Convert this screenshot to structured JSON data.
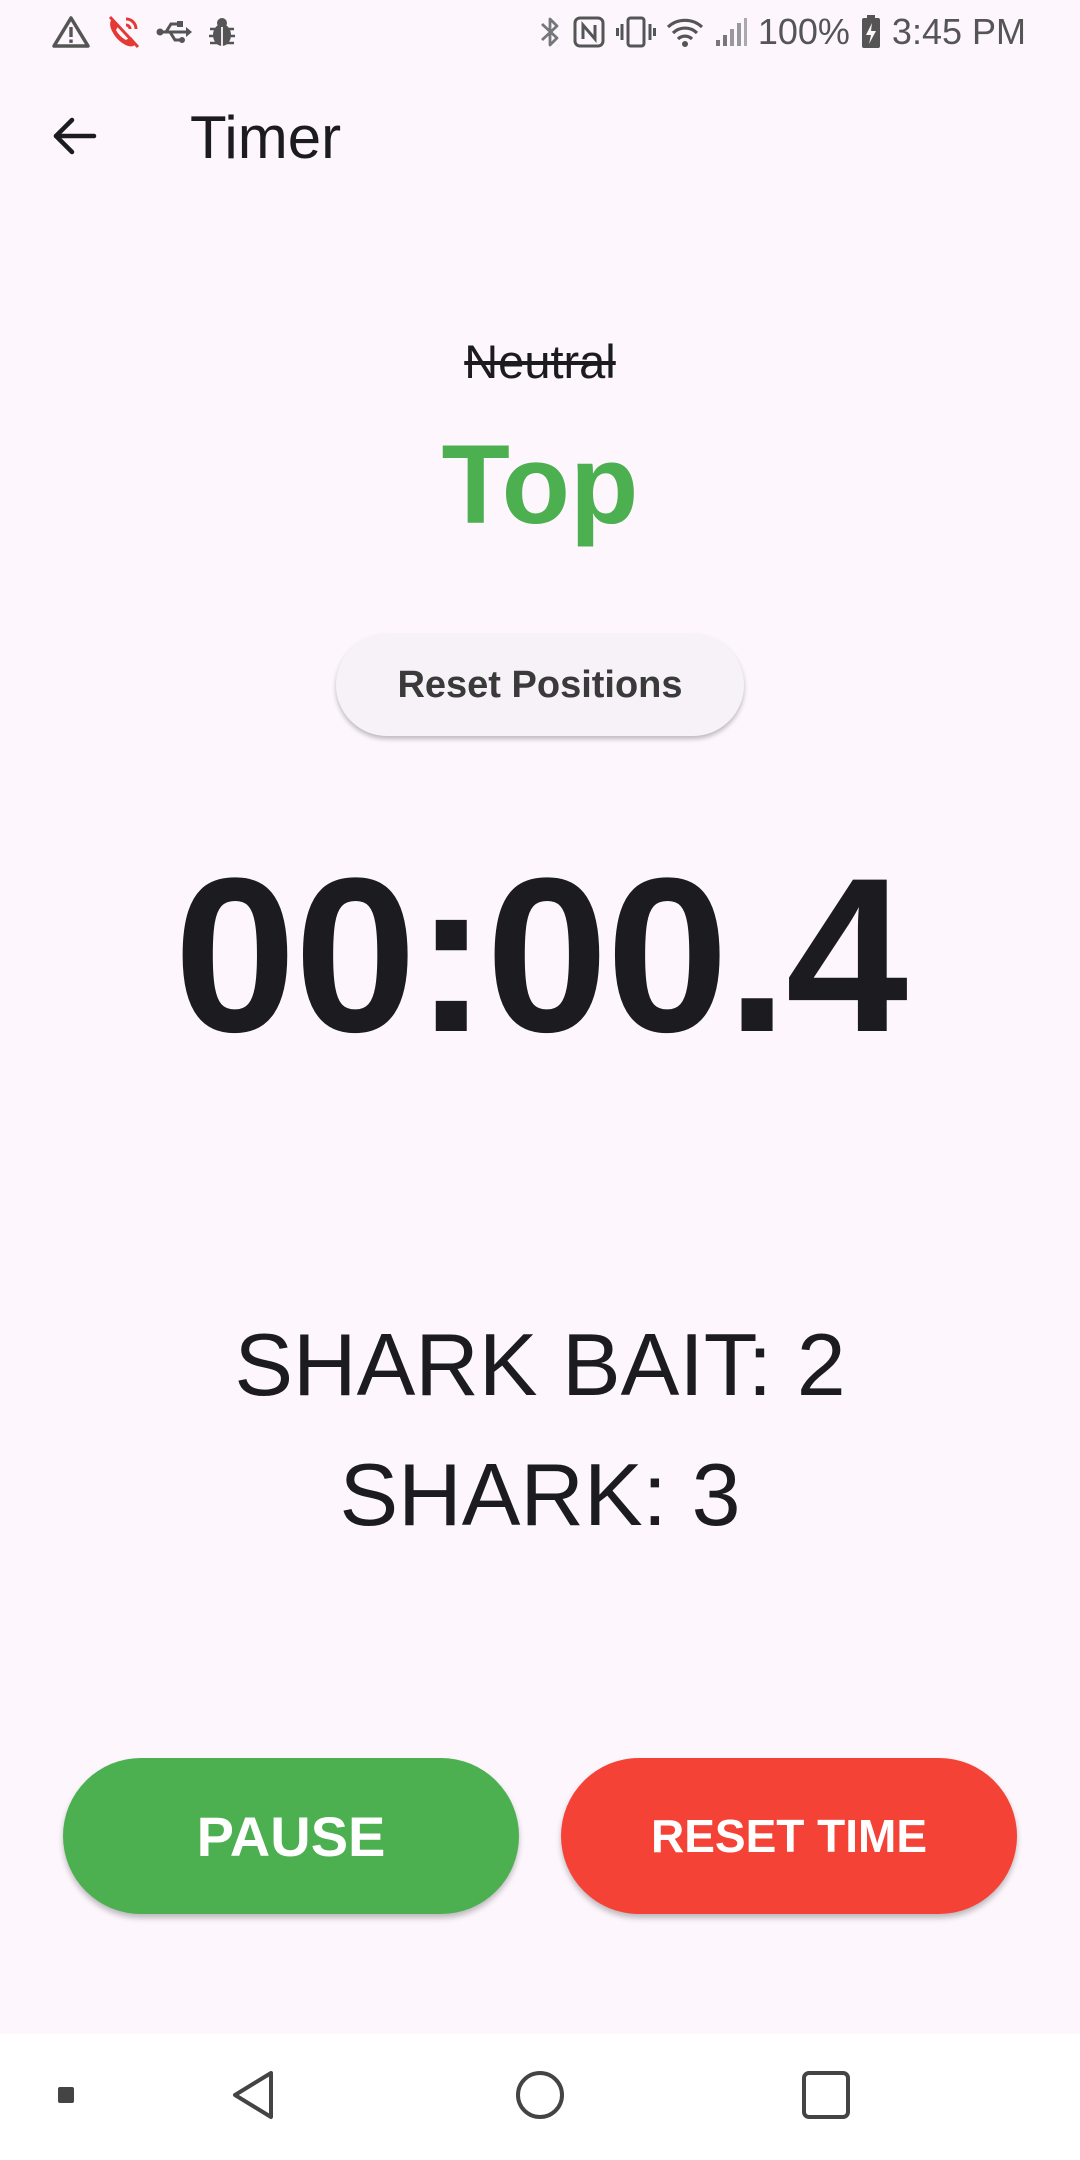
{
  "status_bar": {
    "left_icons": [
      "warning-icon",
      "call-muted-icon",
      "usb-icon",
      "bug-icon"
    ],
    "right_icons": [
      "bluetooth-icon",
      "nfc-icon",
      "vibrate-icon",
      "wifi-icon",
      "signal-icon",
      "battery-icon"
    ],
    "battery_text": "100%",
    "time": "3:45 PM"
  },
  "app_bar": {
    "title": "Timer",
    "back_icon": "arrow-back-icon"
  },
  "positions": {
    "previous": "Neutral",
    "current": "Top",
    "current_color": "#4caf50",
    "reset_label": "Reset Positions"
  },
  "timer": {
    "value": "00:00.4"
  },
  "scores": {
    "line1": "SHARK BAIT: 2",
    "line2": "SHARK: 3"
  },
  "actions": {
    "pause_label": "PAUSE",
    "pause_color": "#4caf50",
    "reset_label": "RESET TIME",
    "reset_color": "#f44336"
  },
  "nav_bar": {
    "items": [
      "menu-square-icon",
      "back-triangle-icon",
      "home-circle-icon",
      "recents-square-icon"
    ]
  }
}
